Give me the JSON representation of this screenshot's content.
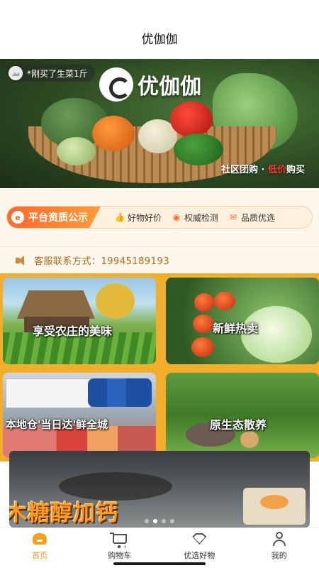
{
  "header": {
    "title": "优伽伽"
  },
  "banner": {
    "brand": "优伽伽",
    "notice": "*刚买了生菜1斤",
    "slogan_prefix": "社区团购 · ",
    "slogan_highlight": "低价",
    "slogan_suffix": "购买"
  },
  "platform": {
    "main_label": "平台资质公示",
    "items": [
      {
        "label": "好物好价",
        "icon": "thumbs-up-icon"
      },
      {
        "label": "权威检测",
        "icon": "badge-icon"
      },
      {
        "label": "品质优选",
        "icon": "mail-icon"
      }
    ]
  },
  "service": {
    "text": "客服联系方式：19945189193"
  },
  "cards": [
    {
      "caption": "享受农庄的美味"
    },
    {
      "caption": "新鲜热卖"
    },
    {
      "caption": "本地仓'当日达'鲜全城"
    },
    {
      "caption": "原生态散养"
    }
  ],
  "promo": {
    "text": "木糖醇加钙",
    "active_dot": 1,
    "dot_count": 4
  },
  "tabbar": {
    "tabs": [
      {
        "label": "首页",
        "icon": "home-icon",
        "active": true
      },
      {
        "label": "购物车",
        "icon": "cart-icon",
        "active": false
      },
      {
        "label": "优选好物",
        "icon": "gem-icon",
        "active": false
      },
      {
        "label": "我的",
        "icon": "user-icon",
        "active": false
      }
    ]
  },
  "colors": {
    "accent": "#f29b1c",
    "strip_gradient_start": "#ff6a2b",
    "grid_bg": "#f2ad2b",
    "service_text": "#b06a1c"
  }
}
